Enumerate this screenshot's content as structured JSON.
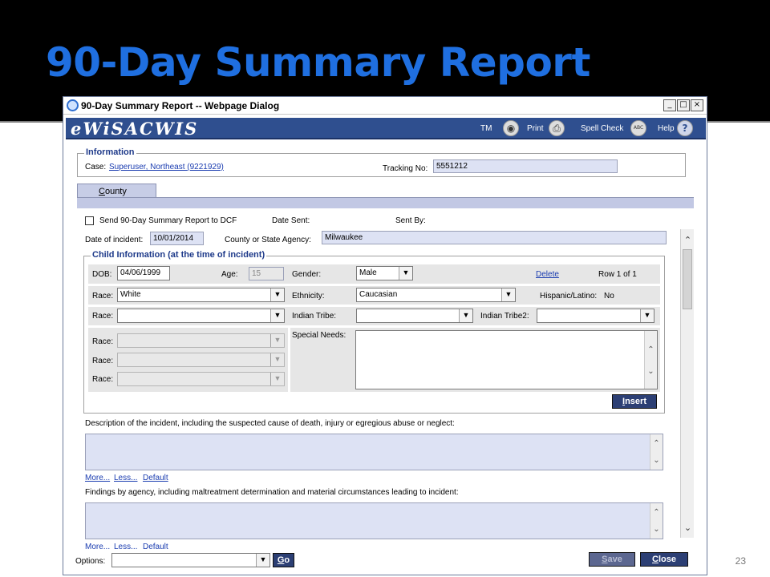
{
  "slide": {
    "title": "90-Day Summary Report",
    "page_number": "23"
  },
  "dialog": {
    "title": "90-Day Summary Report -- Webpage Dialog",
    "window_buttons": {
      "minimize": "_",
      "maximize": "□",
      "close": "×"
    }
  },
  "header": {
    "brand": "eWiSACWIS",
    "links": {
      "tm": "TM",
      "print": "Print",
      "spell_check": "Spell Check",
      "help": "Help"
    },
    "icons": {
      "tm": "globe-icon",
      "print": "printer-icon",
      "spell_check": "spellcheck-icon",
      "help": "help-icon"
    },
    "spell_icon_text": "ABC",
    "help_icon_text": "?"
  },
  "information": {
    "legend": "Information",
    "case_label": "Case:",
    "case_value": "Superuser, Northeast  (9221929)",
    "tracking_label": "Tracking No:",
    "tracking_value": "5551212"
  },
  "tab": {
    "mnemonic": "C",
    "rest": "ounty"
  },
  "report": {
    "send_label": "Send 90-Day Summary Report to DCF",
    "date_sent_label": "Date Sent:",
    "sent_by_label": "Sent By:",
    "date_incident_label": "Date of incident:",
    "date_incident_value": "10/01/2014",
    "agency_label": "County or State Agency:",
    "agency_value": "Milwaukee"
  },
  "child_info": {
    "legend": "Child Information (at the time of incident)",
    "dob_label": "DOB:",
    "dob_value": "04/06/1999",
    "age_label": "Age:",
    "age_value": "15",
    "gender_label": "Gender:",
    "gender_value": "Male",
    "delete_label": "Delete",
    "row_label": "Row 1 of 1",
    "race_label": "Race:",
    "race_value": "White",
    "ethnicity_label": "Ethnicity:",
    "ethnicity_value": "Caucasian",
    "hispanic_label": "Hispanic/Latino:",
    "hispanic_value": "No",
    "indian_tribe_label": "Indian Tribe:",
    "indian_tribe2_label": "Indian Tribe2:",
    "special_needs_label": "Special Needs:",
    "insert": {
      "mnemonic": "I",
      "rest": "nsert"
    }
  },
  "description": {
    "label": "Description of the incident, including the suspected cause of death, injury or egregious abuse or neglect:",
    "more": "More...",
    "less": "Less...",
    "default": "Default"
  },
  "findings": {
    "label": "Findings by agency, including maltreatment determination and material circumstances leading to incident:",
    "more": "More...",
    "less": "Less...",
    "default": "Default"
  },
  "footer": {
    "options_label": "Options:",
    "go": {
      "mnemonic": "G",
      "rest": "o"
    },
    "save": {
      "mnemonic": "S",
      "rest": "ave"
    },
    "close": {
      "mnemonic": "C",
      "rest": "lose"
    }
  }
}
